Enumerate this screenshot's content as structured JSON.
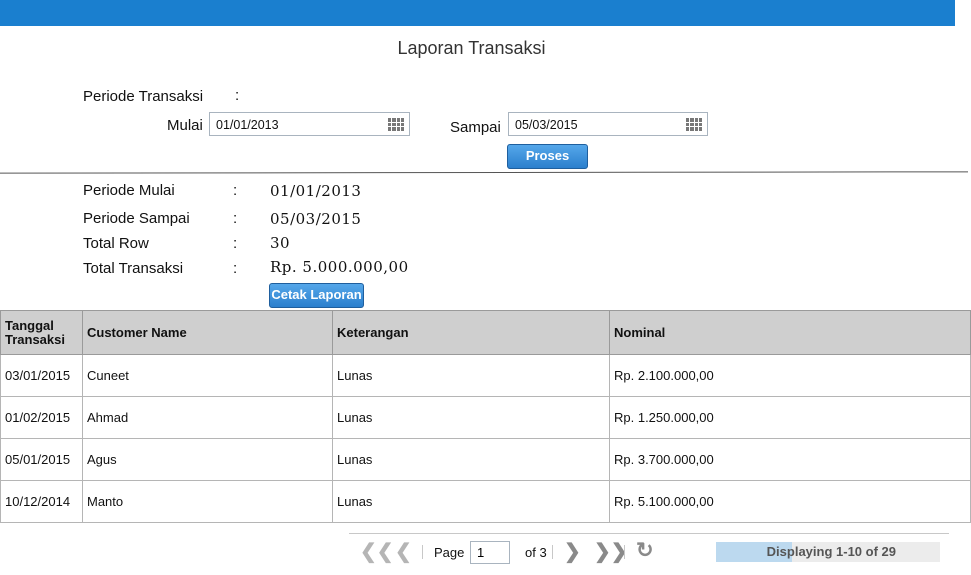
{
  "header": {
    "title": "Laporan Transaksi"
  },
  "filter": {
    "periode_label": "Periode Transaksi",
    "colon": ":",
    "start_label": "Mulai",
    "start_value": "01/01/2013",
    "end_label": "Sampai",
    "end_value": "05/03/2015",
    "process_button": "Proses"
  },
  "summary": {
    "rows": [
      {
        "label": "Periode Mulai",
        "colon": ":",
        "value": "01/01/2013"
      },
      {
        "label": "Periode Sampai",
        "colon": ":",
        "value": "05/03/2015"
      },
      {
        "label": "Total Row",
        "colon": ":",
        "value": "30"
      },
      {
        "label": "Total Transaksi",
        "colon": ":",
        "value": "Rp. 5.000.000,00"
      }
    ],
    "print_button": "Cetak Laporan"
  },
  "table": {
    "columns": [
      "Tanggal Transaksi",
      "Customer Name",
      "Keterangan",
      "Nominal"
    ],
    "rows": [
      [
        "03/01/2015",
        "Cuneet",
        "Lunas",
        "Rp. 2.100.000,00"
      ],
      [
        "01/02/2015",
        "Ahmad",
        "Lunas",
        "Rp. 1.250.000,00"
      ],
      [
        "05/01/2015",
        "Agus",
        "Lunas",
        "Rp. 3.700.000,00"
      ],
      [
        "10/12/2014",
        "Manto",
        "Lunas",
        "Rp. 5.100.000,00"
      ]
    ]
  },
  "pager": {
    "page_label": "Page",
    "page_value": "1",
    "of_label": "of 3",
    "display_text": "Displaying 1-10 of 29",
    "display_fill": 0.34,
    "icons": [
      "first-page-icon",
      "prev-page-icon",
      "next-page-icon",
      "last-page-icon",
      "refresh-icon"
    ]
  },
  "colors": {
    "topbar": "#1a7fcf",
    "button": "#2b7fcd",
    "header_bg": "#cfcfcf"
  }
}
